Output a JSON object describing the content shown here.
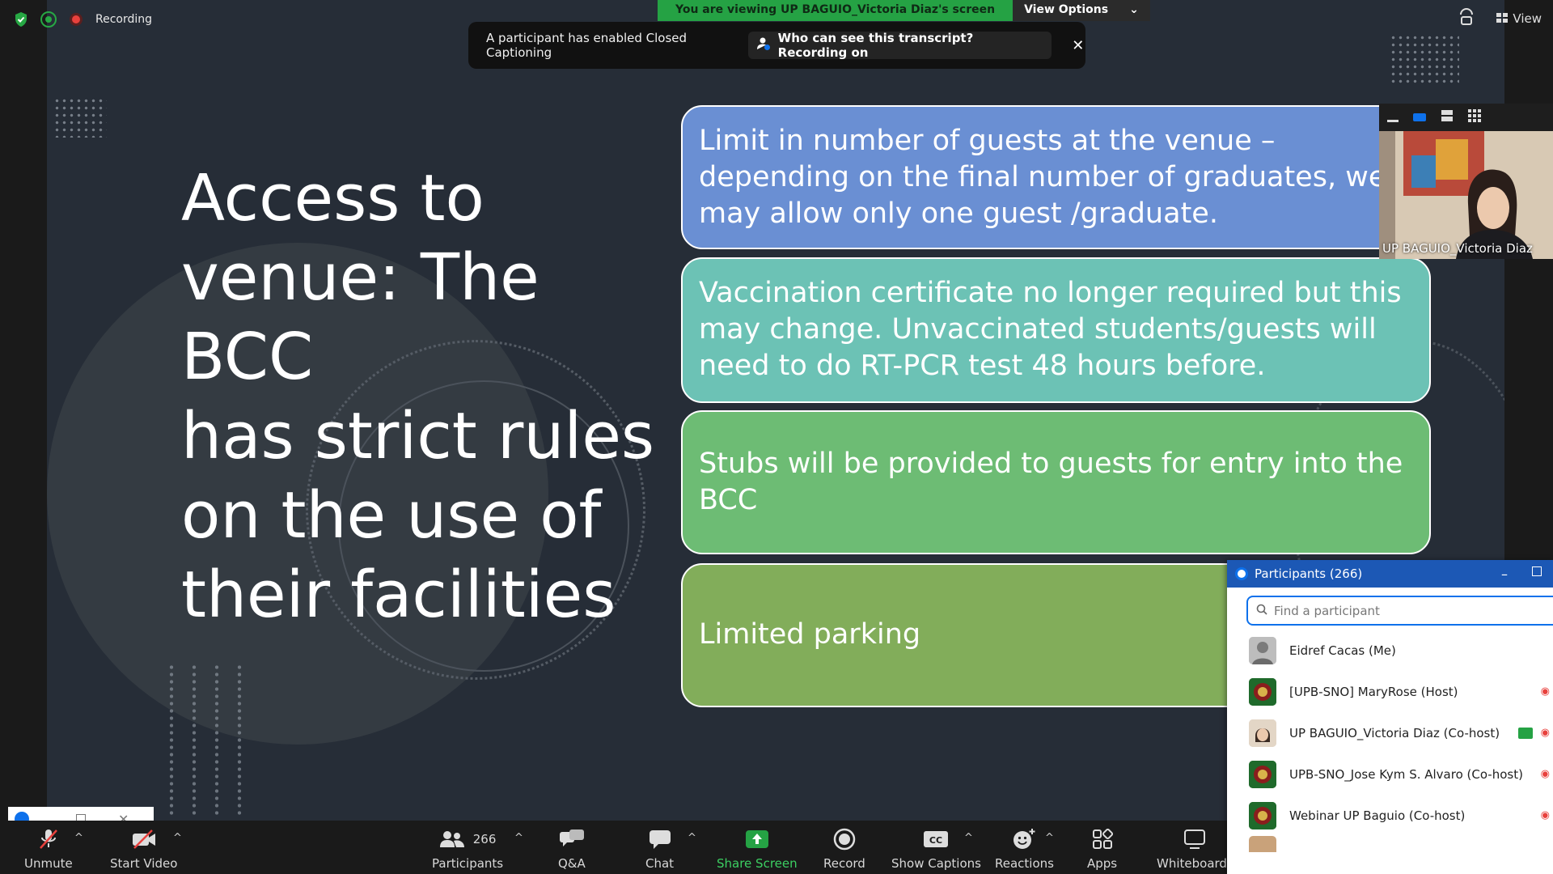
{
  "topbar": {
    "recording_label": "Recording",
    "viewing_banner": "You are viewing UP BAGUIO_Victoria Diaz's screen",
    "view_options_label": "View Options",
    "view_label": "View"
  },
  "cc_banner": {
    "message": "A participant has enabled Closed Captioning",
    "transcript_button": "Who can see this transcript? Recording on"
  },
  "slide": {
    "title_lines": [
      "Access to",
      "venue: The BCC",
      "has strict rules",
      "on the use of",
      "their facilities"
    ],
    "boxes": [
      {
        "text": "Limit in number of guests at the venue – depending on the final number of graduates, we may allow only one guest /graduate.",
        "color": "#6a8fd3"
      },
      {
        "text": "Vaccination certificate no longer required but this may change. Unvaccinated students/guests will need to do RT-PCR test 48 hours before.",
        "color": "#6cc2b5"
      },
      {
        "text": "Stubs will be provided to guests for entry into the BCC",
        "color": "#6dbc74"
      },
      {
        "text": "Limited parking",
        "color": "#82ad5a"
      }
    ]
  },
  "video": {
    "name": "UP BAGUIO_Victoria Diaz"
  },
  "toolbar": {
    "unmute": "Unmute",
    "start_video": "Start Video",
    "participants_count": "266",
    "participants": "Participants",
    "qa": "Q&A",
    "chat": "Chat",
    "share_screen": "Share Screen",
    "record": "Record",
    "show_captions": "Show Captions",
    "reactions": "Reactions",
    "apps": "Apps",
    "whiteboards": "Whiteboards"
  },
  "participants_panel": {
    "title": "Participants (266)",
    "search_placeholder": "Find a participant",
    "rows": [
      {
        "name": "Eidref Cacas (Me)"
      },
      {
        "name": "[UPB-SNO] MaryRose (Host)"
      },
      {
        "name": "UP BAGUIO_Victoria Diaz (Co-host)"
      },
      {
        "name": "UPB-SNO_Jose Kym S. Alvaro (Co-host)"
      },
      {
        "name": "Webinar UP Baguio (Co-host)"
      }
    ]
  },
  "colors": {
    "share_green": "#25a244",
    "panel_blue": "#1c58b5",
    "accent_blue": "#0e71eb",
    "recording_red": "#e8413d"
  }
}
